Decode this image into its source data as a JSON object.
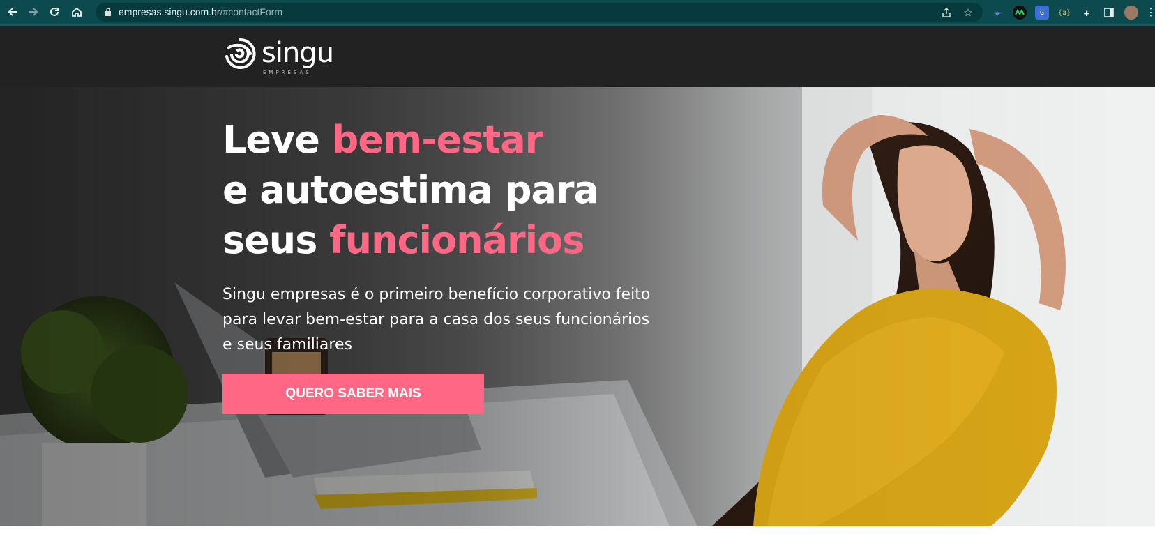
{
  "browser": {
    "url_host": "empresas.singu.com.br",
    "url_path": "/#contactForm",
    "icons": [
      "back-icon",
      "forward-icon",
      "reload-icon",
      "home-icon",
      "lock-icon",
      "share-icon",
      "star-icon",
      "extensions-icon",
      "side-panel-icon",
      "profile-avatar"
    ]
  },
  "header": {
    "logo_text": "singu",
    "logo_subtext": "EMPRESAS"
  },
  "hero": {
    "headline": {
      "line1_white": "Leve ",
      "line1_pink": "bem-estar",
      "line2_white": "e autoestima para",
      "line3_white": "seus ",
      "line3_pink": "funcionários"
    },
    "description_lines": [
      "Singu empresas é o primeiro benefício corporativo feito",
      "para levar bem-estar para a casa dos seus funcionários",
      "e seus familiares"
    ],
    "cta_label": "QUERO SABER MAIS"
  },
  "colors": {
    "accent_pink": "#ff6784",
    "header_bg": "#222222",
    "chrome_bg": "#0c4a4e"
  }
}
